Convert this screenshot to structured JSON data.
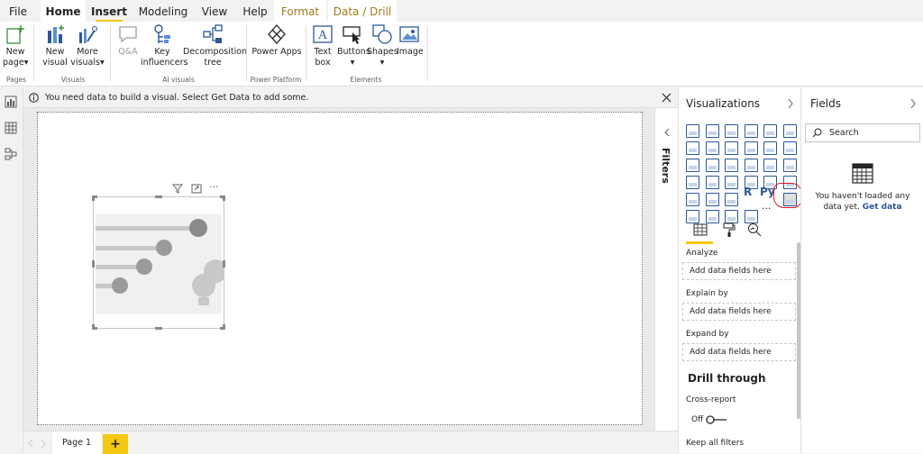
{
  "tabs": [
    {
      "label": "File"
    },
    {
      "label": "Home"
    },
    {
      "label": "Insert"
    },
    {
      "label": "Modeling"
    },
    {
      "label": "View"
    },
    {
      "label": "Help"
    },
    {
      "label": "Format"
    },
    {
      "label": "Data / Drill"
    }
  ],
  "ribbon": {
    "new_page": "New",
    "new_page2": "page",
    "new_visual": "New",
    "new_visual2": "visual",
    "more_visuals": "More",
    "more_visuals2": "visuals",
    "qa": "Q&A",
    "key_influencers": "Key",
    "key_influencers2": "influencers",
    "decomp": "Decomposition",
    "decomp2": "tree",
    "power_apps": "Power Apps",
    "text_box": "Text",
    "text_box2": "box",
    "buttons": "Buttons",
    "shapes": "Shapes",
    "image": "Image",
    "groups": {
      "pages": "Pages",
      "visuals": "Visuals",
      "ai": "AI visuals",
      "platform": "Power Platform",
      "elements": "Elements"
    }
  },
  "infobar": {
    "message": "You need data to build a visual. Select Get Data to add some."
  },
  "filters": {
    "label": "Filters"
  },
  "viz": {
    "title": "Visualizations",
    "analyze": "Analyze",
    "explain": "Explain by",
    "expand": "Expand by",
    "placeholder": "Add data fields here",
    "drill": "Drill through",
    "cross": "Cross-report",
    "off": "Off",
    "keep": "Keep all filters",
    "r_label": "R",
    "py_label": "Py",
    "more": "···"
  },
  "fields": {
    "title": "Fields",
    "search": "Search",
    "empty1": "You haven't loaded any",
    "empty2": "data yet.",
    "link": "Get data"
  },
  "pages": {
    "page1": "Page 1",
    "add": "+"
  },
  "visual": {
    "more": "···"
  }
}
